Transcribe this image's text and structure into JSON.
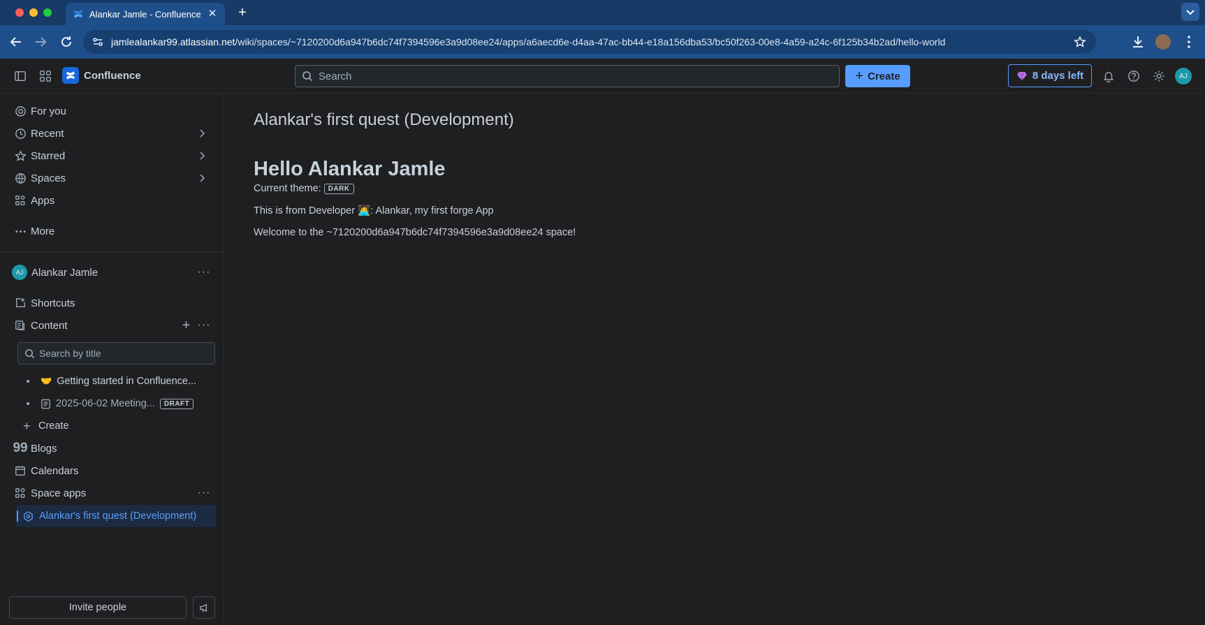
{
  "browser": {
    "tab_title": "Alankar Jamle - Confluence",
    "url_host": "jamlealankar99.atlassian.net",
    "url_path": "/wiki/spaces/~7120200d6a947b6dc74f7394596e3a9d08ee24/apps/a6aecd6e-d4aa-47ac-bb44-e18a156dba53/bc50f263-00e8-4a59-a24c-6f125b34b2ad/hello-world"
  },
  "topnav": {
    "product_name": "Confluence",
    "search_placeholder": "Search",
    "create_label": "Create",
    "trial_label": "8 days left",
    "avatar_initials": "AJ"
  },
  "sidebar": {
    "items": [
      {
        "label": "For you",
        "icon": "target-icon"
      },
      {
        "label": "Recent",
        "icon": "clock-icon"
      },
      {
        "label": "Starred",
        "icon": "star-icon"
      },
      {
        "label": "Spaces",
        "icon": "globe-icon"
      },
      {
        "label": "Apps",
        "icon": "apps-icon"
      },
      {
        "label": "More",
        "icon": "more-icon"
      }
    ],
    "space": {
      "name": "Alankar Jamle",
      "avatar_initials": "AJ",
      "shortcuts_label": "Shortcuts",
      "content_label": "Content",
      "search_placeholder": "Search by title",
      "pages": [
        {
          "emoji": "🤝",
          "title": "Getting started in Confluence..."
        },
        {
          "title": "2025-06-02 Meeting...",
          "badge": "DRAFT"
        }
      ],
      "create_label": "Create",
      "blogs_label": "Blogs",
      "calendars_label": "Calendars",
      "space_apps_label": "Space apps",
      "active_app_label": "Alankar's first quest (Development)"
    },
    "invite_label": "Invite people"
  },
  "main": {
    "page_title": "Alankar's first quest (Development)",
    "heading": "Hello Alankar Jamle",
    "theme_label": "Current theme:",
    "theme_value": "DARK",
    "developer_line": "This is from Developer 🧑‍💻: Alankar, my first forge App",
    "welcome_line": "Welcome to the ~7120200d6a947b6dc74f7394596e3a9d08ee24 space!"
  },
  "colors": {
    "accent": "#579dff",
    "chrome_blue": "#1f4f8a",
    "background": "#1f1f21"
  }
}
